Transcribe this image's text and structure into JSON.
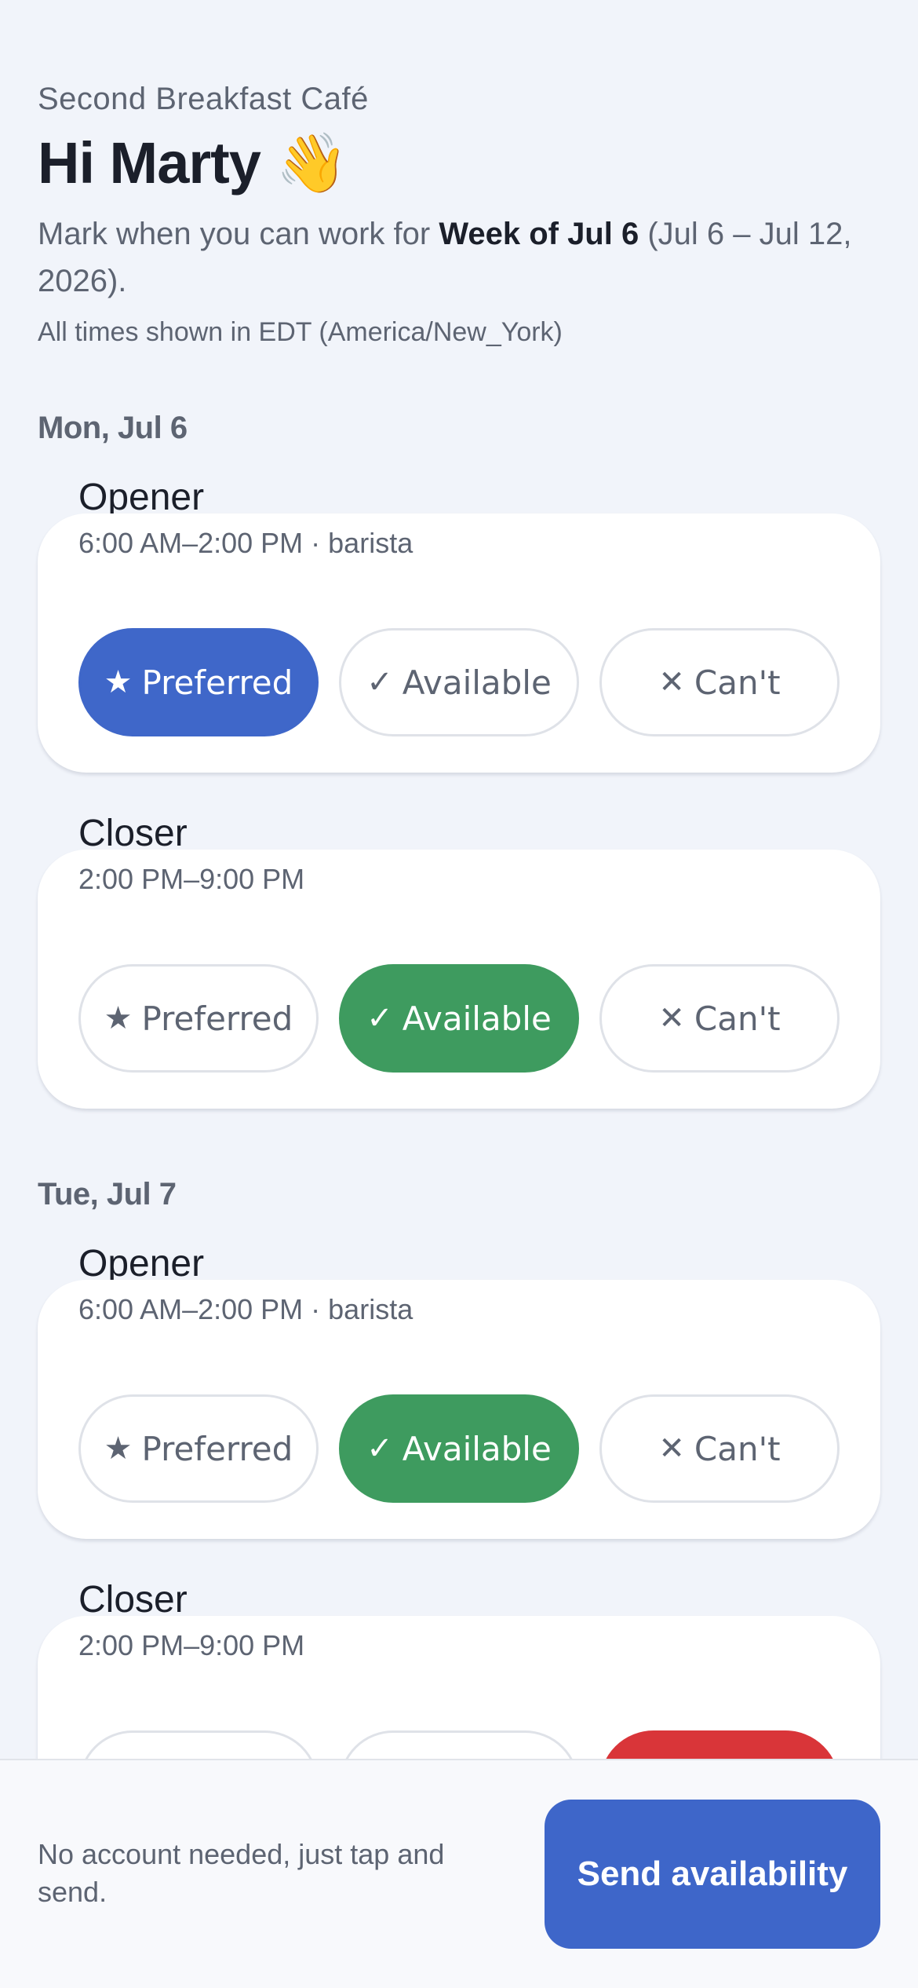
{
  "header": {
    "cafe_name": "Second Breakfast Café",
    "greeting": "Hi Marty",
    "greeting_emoji": "👋",
    "intro_prefix": "Mark when you can work for ",
    "intro_week": "Week of Jul 6",
    "intro_suffix": " (Jul 6 – Jul 12, 2026).",
    "timezone_note": "All times shown in EDT (America/New_York)"
  },
  "option_labels": {
    "preferred": "Preferred",
    "available": "Available",
    "cant": "Can't"
  },
  "option_icons": {
    "preferred": "★",
    "available": "✓",
    "cant": "✕"
  },
  "colors": {
    "preferred_selected": "#3f67c9",
    "available_selected": "#3e9b5f",
    "cant_selected": "#d93539",
    "send_button": "#3e66c9"
  },
  "days": [
    {
      "label": "Mon, Jul 6",
      "shifts": [
        {
          "name": "Opener",
          "time": "6:00 AM–2:00 PM · barista",
          "selected": "preferred"
        },
        {
          "name": "Closer",
          "time": "2:00 PM–9:00 PM",
          "selected": "available"
        }
      ]
    },
    {
      "label": "Tue, Jul 7",
      "shifts": [
        {
          "name": "Opener",
          "time": "6:00 AM–2:00 PM · barista",
          "selected": "available"
        },
        {
          "name": "Closer",
          "time": "2:00 PM–9:00 PM",
          "selected": "cant"
        }
      ]
    }
  ],
  "footer": {
    "note": "No account needed, just tap and send.",
    "send_label": "Send availability"
  }
}
